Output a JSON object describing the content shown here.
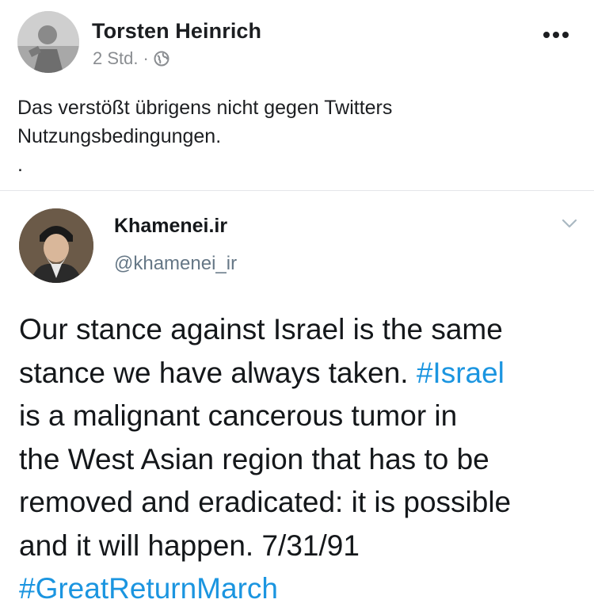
{
  "post": {
    "author": "Torsten Heinrich",
    "time": "2 Std.",
    "separator": "·",
    "privacy_icon": "globe-icon",
    "more_icon": "more-horizontal-icon",
    "text_lines": [
      "Das verstößt übrigens nicht gegen Twitters",
      "Nutzungsbedingungen.",
      "."
    ]
  },
  "tweet": {
    "display_name": "Khamenei.ir",
    "handle": "@khamenei_ir",
    "menu_icon": "chevron-down-icon",
    "lines": {
      "l1": "Our stance against Israel is the same",
      "l2_pre": "stance we have always taken. ",
      "l2_tag": "#Israel",
      "l3": "is a malignant cancerous tumor in",
      "l4": "the West Asian region that has to be",
      "l5": "removed and eradicated: it is possible",
      "l6": "and it will happen. 7/31/91",
      "l7_tag": "#GreatReturnMarch"
    }
  },
  "colors": {
    "text": "#1c1e21",
    "meta": "#8a8d91",
    "tweet_text": "#14171a",
    "tweet_handle": "#657786",
    "hashtag": "#1b95e0"
  }
}
